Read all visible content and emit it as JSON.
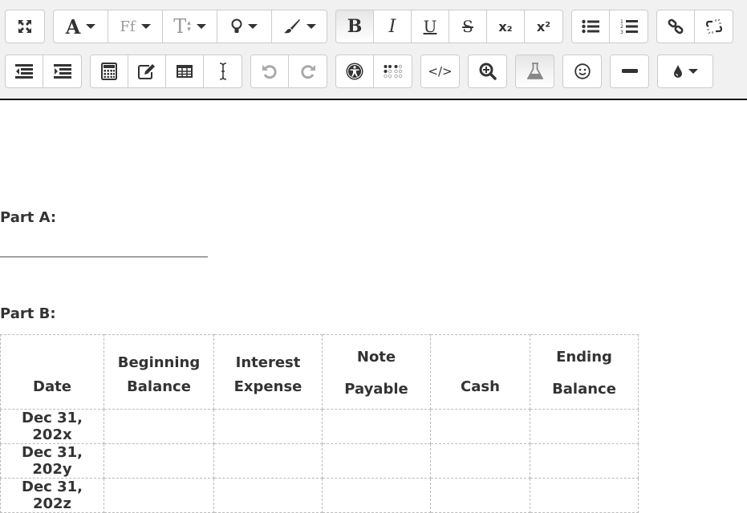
{
  "toolbar": {
    "row1": [
      {
        "group": "fullscreen",
        "buttons": [
          {
            "name": "fullscreen-button",
            "icon": "expand-icon"
          }
        ]
      },
      {
        "group": "font",
        "buttons": [
          {
            "name": "font-color-button",
            "icon": "font-color-icon",
            "glyph": "A"
          },
          {
            "name": "font-family-button",
            "icon": "font-family-icon",
            "glyph": "Ff"
          },
          {
            "name": "font-size-button",
            "icon": "font-size-icon",
            "glyph": "T"
          },
          {
            "name": "highlight-button",
            "icon": "lightbulb-icon"
          },
          {
            "name": "paint-button",
            "icon": "paintbrush-icon"
          }
        ]
      },
      {
        "group": "format",
        "buttons": [
          {
            "name": "bold-button",
            "glyph": "B"
          },
          {
            "name": "italic-button",
            "glyph": "I"
          },
          {
            "name": "underline-button",
            "glyph": "U"
          },
          {
            "name": "strikethrough-button",
            "glyph": "S"
          },
          {
            "name": "subscript-button",
            "glyph": "x₂"
          },
          {
            "name": "superscript-button",
            "glyph": "x²"
          }
        ]
      },
      {
        "group": "lists",
        "buttons": [
          {
            "name": "bullet-list-button",
            "icon": "bullet-list-icon"
          },
          {
            "name": "numbered-list-button",
            "icon": "numbered-list-icon"
          }
        ]
      },
      {
        "group": "links",
        "buttons": [
          {
            "name": "link-button",
            "icon": "link-icon"
          },
          {
            "name": "unlink-button",
            "icon": "unlink-icon"
          }
        ]
      }
    ],
    "row2": [
      {
        "group": "indent",
        "buttons": [
          {
            "name": "outdent-button",
            "icon": "outdent-icon"
          },
          {
            "name": "indent-button",
            "icon": "indent-icon"
          }
        ]
      },
      {
        "group": "insert",
        "buttons": [
          {
            "name": "calculator-button",
            "icon": "calculator-icon"
          },
          {
            "name": "edit-button",
            "icon": "edit-icon"
          },
          {
            "name": "table-button",
            "icon": "table-icon"
          },
          {
            "name": "cursor-button",
            "icon": "text-cursor-icon"
          }
        ]
      },
      {
        "group": "history",
        "buttons": [
          {
            "name": "undo-button",
            "icon": "undo-icon"
          },
          {
            "name": "redo-button",
            "icon": "redo-icon"
          }
        ]
      },
      {
        "group": "accessibility",
        "buttons": [
          {
            "name": "accessibility-button",
            "icon": "accessibility-icon"
          },
          {
            "name": "braille-button",
            "icon": "braille-icon"
          }
        ]
      },
      {
        "group": "html",
        "buttons": [
          {
            "name": "html-button",
            "icon": "code-icon",
            "glyph": "</>"
          }
        ]
      },
      {
        "group": "zoom",
        "buttons": [
          {
            "name": "zoom-button",
            "icon": "zoom-in-icon"
          }
        ]
      },
      {
        "group": "science",
        "buttons": [
          {
            "name": "chemistry-button",
            "icon": "flask-icon"
          }
        ]
      },
      {
        "group": "emoji",
        "buttons": [
          {
            "name": "emoji-button",
            "icon": "smiley-icon"
          }
        ]
      },
      {
        "group": "hr",
        "buttons": [
          {
            "name": "horizontal-rule-button",
            "icon": "minus-icon"
          }
        ]
      },
      {
        "group": "color",
        "buttons": [
          {
            "name": "text-color-button",
            "icon": "droplet-icon"
          }
        ]
      }
    ]
  },
  "content": {
    "part_a_label": "Part A:",
    "part_a_blank": "________________________________",
    "part_b_label": "Part B:",
    "table": {
      "headers": [
        [
          "",
          "Date"
        ],
        [
          "Beginning",
          "Balance"
        ],
        [
          "Interest",
          "Expense"
        ],
        [
          "Note",
          "Payable"
        ],
        [
          "",
          "Cash"
        ],
        [
          "Ending",
          "Balance"
        ]
      ],
      "rows": [
        [
          "Dec 31, 202x",
          "",
          "",
          "",
          "",
          ""
        ],
        [
          "Dec 31, 202y",
          "",
          "",
          "",
          "",
          ""
        ],
        [
          "Dec 31, 202z",
          "",
          "",
          "",
          "",
          ""
        ]
      ]
    }
  }
}
